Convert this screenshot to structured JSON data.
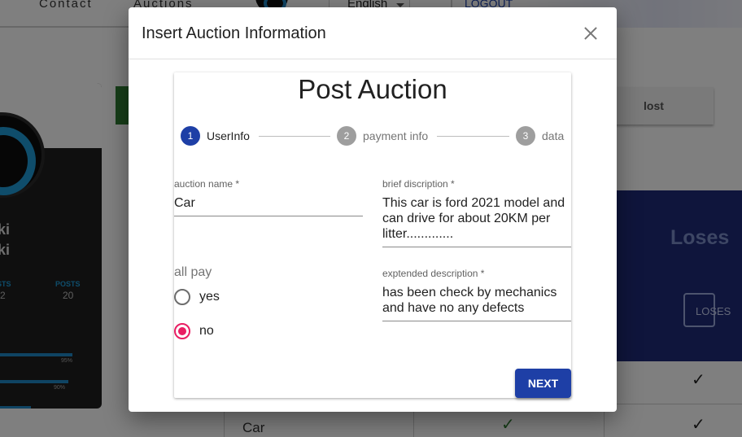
{
  "nav": {
    "contact": "Contact",
    "auctions": "Auctions",
    "language": "English",
    "logout": "LOGOUT"
  },
  "profile": {
    "name_line1": "iki",
    "name_line2": "iki",
    "stat1_label": "STS",
    "stat1_value": "2",
    "stat2_label": "POSTS",
    "stat2_value": "20",
    "progress": [
      {
        "pct_label": "95%",
        "value": 0.95
      },
      {
        "pct_label": "90%",
        "value": 0.9
      },
      {
        "pct_label": "",
        "value": 0.5
      }
    ]
  },
  "background": {
    "lost_tab": "lost",
    "loses_title": "Loses",
    "loses_button": "LOSES",
    "table_cell": "Car"
  },
  "dialog": {
    "title": "Insert Auction Information",
    "card_title": "Post Auction",
    "steps": [
      {
        "number": "1",
        "label": "UserInfo",
        "state": "active"
      },
      {
        "number": "2",
        "label": "payment info",
        "state": "inactive"
      },
      {
        "number": "3",
        "label": "data",
        "state": "inactive"
      }
    ],
    "fields": {
      "auction_name": {
        "label": "auction name *",
        "value": "Car"
      },
      "brief_description": {
        "label": "brief discription *",
        "value": "This car is ford 2021 model and can drive for about 20KM per litter............."
      },
      "extended_description": {
        "label": "exptended description *",
        "value": "has been check by mechanics and have no any defects"
      }
    },
    "all_pay": {
      "label": "all pay",
      "options": [
        {
          "label": "yes",
          "checked": false
        },
        {
          "label": "no",
          "checked": true
        }
      ]
    },
    "next_button": "NEXT"
  },
  "colors": {
    "primary": "#1e3fa6",
    "radio_accent": "#e91e63",
    "loses_panel": "#1e2a78"
  }
}
